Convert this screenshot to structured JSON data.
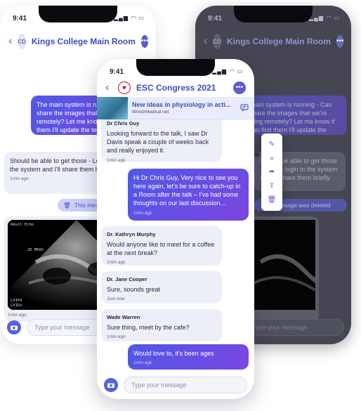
{
  "status_bar": {
    "time": "9:41"
  },
  "left_phone": {
    "title": "Kings College Main Room",
    "avatar_initials": "CD",
    "messages": [
      {
        "text": "The main system is running - Can you share the images that we're receiving remotely? Let me know if you can find them I'll update the team",
        "direction": "out"
      },
      {
        "text": "Should be able to get those - Let me login to the system and I'll share them briefly",
        "time": "1min ago",
        "direction": "in"
      },
      {
        "text": "This message was deleted",
        "direction": "system"
      }
    ],
    "ultrasound_labels": [
      "Adult Echo",
      "2D MEAS",
      "LVIPd",
      "LVIDs"
    ],
    "ultrasound_time": "1min ago",
    "composer_placeholder": "Type your message"
  },
  "right_phone": {
    "title": "Kings College Main Room",
    "avatar_initials": "CD",
    "messages": [
      {
        "text": "The main system is running - Can you share the images that we're receiving remotely? Let me know if you can find them I'll update the team.",
        "direction": "out"
      },
      {
        "text": "Should be able to get those - Let me login to the system and I'll share them briefly",
        "direction": "in"
      },
      {
        "text": "This message was deleted",
        "direction": "system"
      }
    ],
    "composer_placeholder": "Type your message"
  },
  "center_phone": {
    "title": "ESC Congress 2021",
    "banner": {
      "title": "New ideas in physiology in acti...",
      "source": "WondrMedical.net"
    },
    "messages": [
      {
        "sender": "Dr Chris Guy",
        "text": "Looking forward to the talk, I saw Dr Davis speak a couple of weeks back and really enjoyed it.",
        "time": "1min ago",
        "direction": "in"
      },
      {
        "text": "Hi Dr Chris Guy, Very nice to see you here again, let's be sure to catch-up in a Room after the talk – I've had some thoughts on our last discussion...",
        "time": "1min ago",
        "direction": "out"
      },
      {
        "sender": "Dr. Kathryn Murphy",
        "text": "Would anyone like to meet for a coffee at the next break?",
        "time": "1min ago",
        "direction": "in"
      },
      {
        "sender": "Dr. Jane Cooper",
        "text": "Sure, sounds great",
        "time": "Just now",
        "direction": "in"
      },
      {
        "sender": "Wade Warren",
        "text": "Sure thing, meet by the cafe?",
        "time": "1min ago",
        "direction": "in"
      },
      {
        "text": "Would love to, it's been ages",
        "time": "1min ago",
        "direction": "out"
      }
    ],
    "composer_placeholder": "Type your message"
  },
  "context_menu": {
    "items": [
      "reply-icon",
      "forward-icon",
      "share-icon",
      "export-icon",
      "delete-icon"
    ],
    "visible_fragment": "om"
  },
  "colors": {
    "accent": "#5b5bd6",
    "outgoing_start": "#4f58e8",
    "outgoing_end": "#7b46e0",
    "incoming": "#eceef8",
    "dark_bg": "#454651"
  }
}
